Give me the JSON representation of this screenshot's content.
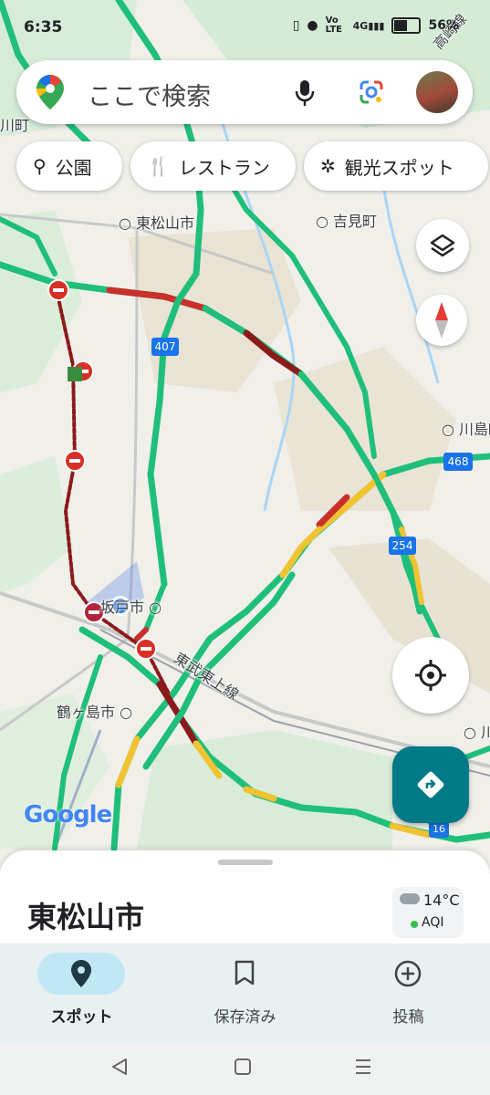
{
  "status_bar": {
    "time": "6:35",
    "network": "Vo LTE",
    "signal_label": "4G",
    "battery_percent": "56%"
  },
  "search": {
    "placeholder": "ここで検索"
  },
  "chips": [
    {
      "label": "公園",
      "icon": "tree-icon"
    },
    {
      "label": "レストラン",
      "icon": "fork-knife-icon"
    },
    {
      "label": "観光スポット",
      "icon": "ferris-wheel-icon"
    }
  ],
  "map": {
    "place_labels": [
      "東松山市",
      "吉見町",
      "川島町",
      "坂戸市",
      "鶴ヶ島市",
      "川",
      "川町",
      "高崎線"
    ],
    "route_shields": [
      "407",
      "468",
      "254",
      "16"
    ],
    "rail_label": "東武東上線",
    "watermark": "Google"
  },
  "bottom_sheet": {
    "title": "東松山市",
    "weather_temp": "14°C",
    "weather_aqi": "AQI"
  },
  "bottom_nav": [
    {
      "label": "スポット",
      "icon": "location-pin-icon",
      "active": true
    },
    {
      "label": "保存済み",
      "icon": "bookmark-icon",
      "active": false
    },
    {
      "label": "投稿",
      "icon": "add-circle-icon",
      "active": false
    }
  ],
  "colors": {
    "traffic_green": "#1fbf7a",
    "traffic_yellow": "#f2c331",
    "traffic_red": "#c9302c",
    "traffic_darkred": "#8b1a1a",
    "directions_button": "#007a87",
    "closure_red": "#d93025"
  }
}
